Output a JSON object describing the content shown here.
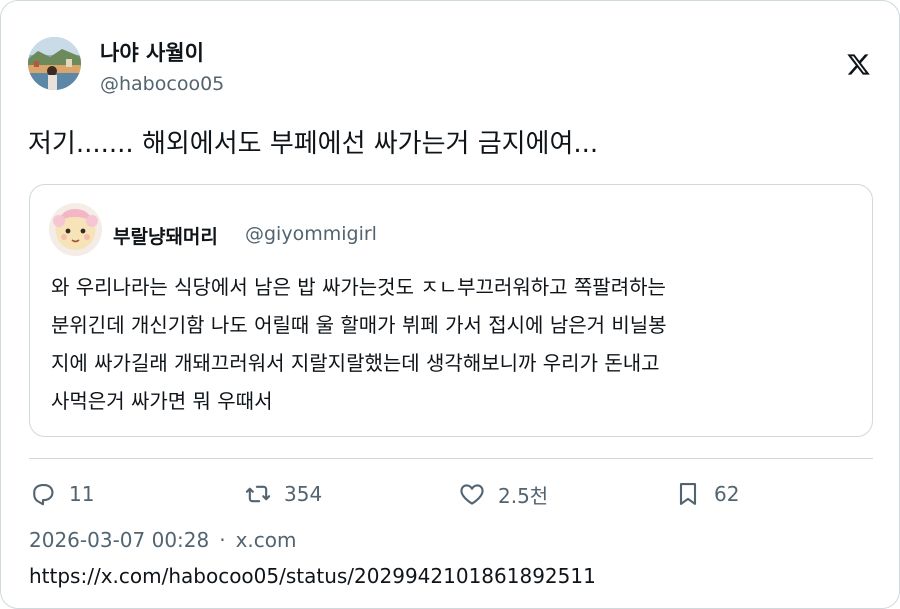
{
  "author": {
    "display_name": "나야 사월이",
    "handle": "@habocoo05"
  },
  "brand": {
    "logo_icon": "x-logo-icon",
    "color": "#0f1419"
  },
  "tweet": {
    "text": "저기....... 해외에서도 부페에선 싸가는거 금지에여..."
  },
  "quoted": {
    "display_name": "부랄냥돼머리",
    "handle": "@giyommigirl",
    "lines": [
      "와 우리나라는 식당에서 남은 밥 싸가는것도 ㅈㄴ부끄러워하고 쪽팔려하는",
      "분위긴데 개신기함 나도 어릴때 울 할매가 뷔페 가서 접시에 남은거 비닐봉",
      "지에 싸가길래 개돼끄러워서 지랄지랄했는데 생각해보니까 우리가 돈내고",
      "사먹은거 싸가면 뭐 우때서"
    ]
  },
  "actions": {
    "replies": "11",
    "reposts": "354",
    "likes": "2.5천",
    "bookmarks": "62"
  },
  "meta": {
    "timestamp": "2026-03-07 00:28",
    "separator": "·",
    "source": "x.com"
  },
  "url": "https://x.com/habocoo05/status/2029942101861892511",
  "colors": {
    "text": "#0f1419",
    "secondary": "#536471",
    "border": "#cfd9de"
  }
}
